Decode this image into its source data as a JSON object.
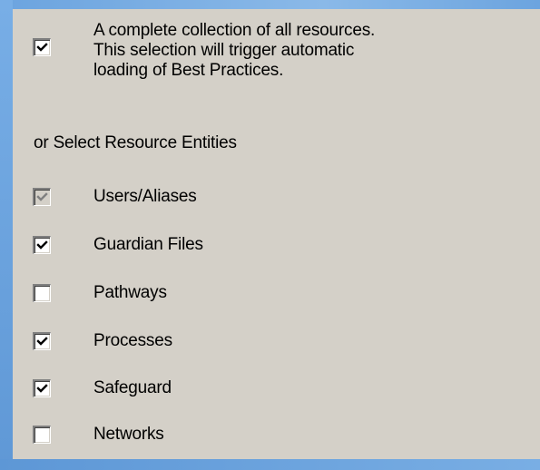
{
  "complete_collection": {
    "checked": true,
    "lines": [
      "A complete collection of all resources.",
      "This selection will trigger automatic",
      "loading of Best Practices."
    ]
  },
  "section_heading": "or Select Resource Entities",
  "entities": [
    {
      "label": "Users/Aliases",
      "checked": true,
      "disabled": true
    },
    {
      "label": "Guardian Files",
      "checked": true,
      "disabled": false
    },
    {
      "label": "Pathways",
      "checked": false,
      "disabled": false
    },
    {
      "label": "Processes",
      "checked": true,
      "disabled": false
    },
    {
      "label": "Safeguard",
      "checked": true,
      "disabled": false
    },
    {
      "label": "Networks",
      "checked": false,
      "disabled": false
    }
  ],
  "colors": {
    "panel": "#d4d0c8",
    "desktop": "#6fa4dc",
    "check_enabled": "#000000",
    "check_disabled": "#808080"
  }
}
